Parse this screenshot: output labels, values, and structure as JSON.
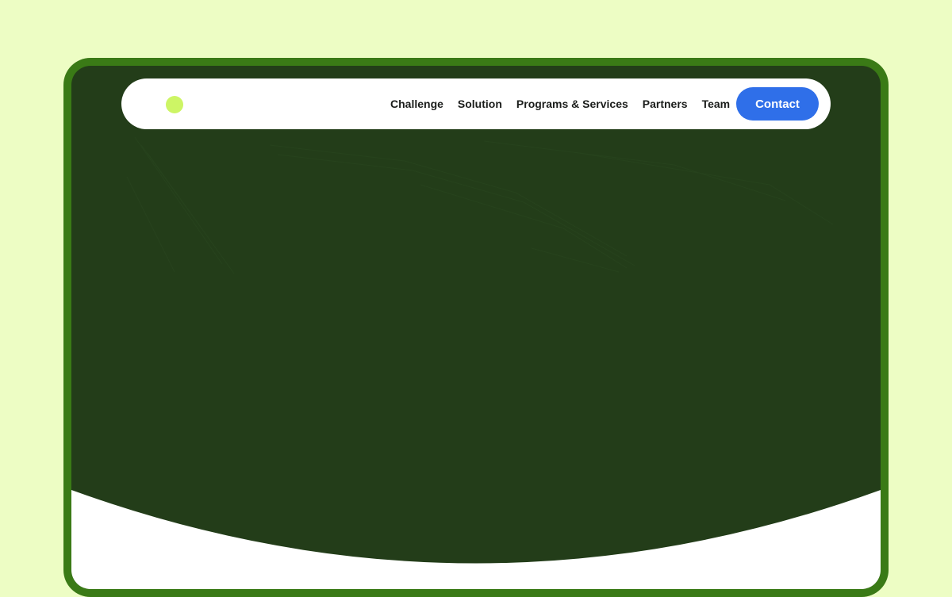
{
  "nav": {
    "items": [
      {
        "label": "Challenge"
      },
      {
        "label": "Solution"
      },
      {
        "label": "Programs & Services"
      },
      {
        "label": "Partners"
      },
      {
        "label": "Team"
      }
    ],
    "contact_label": "Contact"
  },
  "colors": {
    "page_background": "#edfdc4",
    "frame": "#3a7a16",
    "hero_background": "#233d19",
    "logo_dot": "#cdf565",
    "cta_button": "#2f6fe9"
  }
}
